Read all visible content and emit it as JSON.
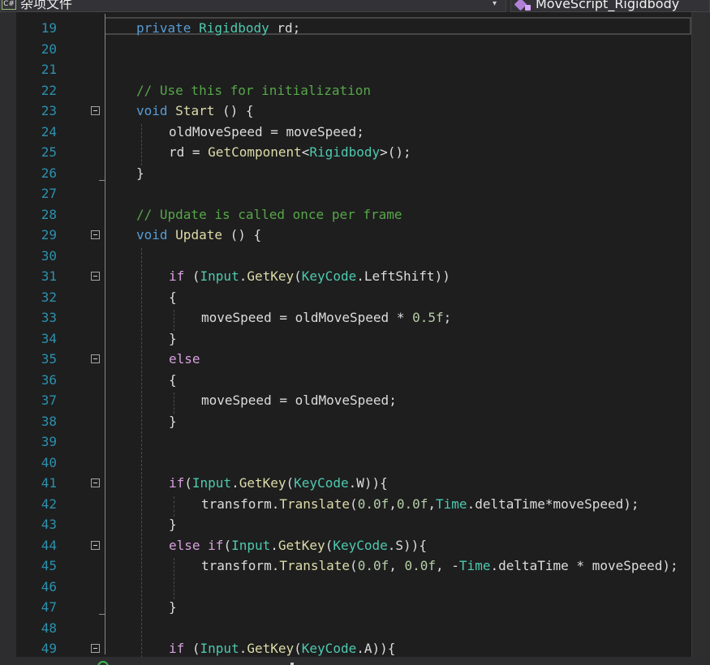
{
  "navbar": {
    "project_badge": "C#",
    "project_label": "杂项文件",
    "chevron": "▾",
    "class_label": "MoveScript_Rigidbody",
    "class_icon": "class-icon"
  },
  "editor": {
    "current_line": 19,
    "lines": [
      {
        "n": 19,
        "indent": 0,
        "tokens": [
          [
            "kw",
            "private"
          ],
          [
            "id",
            " "
          ],
          [
            "ty",
            "Rigidbody"
          ],
          [
            "id",
            " rd;"
          ]
        ]
      },
      {
        "n": 20,
        "indent": 0,
        "tokens": []
      },
      {
        "n": 21,
        "indent": 0,
        "tokens": []
      },
      {
        "n": 22,
        "indent": 0,
        "tokens": [
          [
            "cm",
            "// Use this for initialization"
          ]
        ]
      },
      {
        "n": 23,
        "indent": 0,
        "fold": true,
        "tokens": [
          [
            "kw",
            "void"
          ],
          [
            "id",
            " "
          ],
          [
            "fn",
            "Start"
          ],
          [
            "pn",
            " () {"
          ]
        ]
      },
      {
        "n": 24,
        "indent": 1,
        "tokens": [
          [
            "id",
            "oldMoveSpeed = moveSpeed;"
          ]
        ]
      },
      {
        "n": 25,
        "indent": 1,
        "tokens": [
          [
            "id",
            "rd = "
          ],
          [
            "fn",
            "GetComponent"
          ],
          [
            "pn",
            "<"
          ],
          [
            "ty",
            "Rigidbody"
          ],
          [
            "pn",
            ">();"
          ]
        ]
      },
      {
        "n": 26,
        "indent": 0,
        "fold_end": true,
        "tokens": [
          [
            "pn",
            "}"
          ]
        ]
      },
      {
        "n": 27,
        "indent": 0,
        "tokens": []
      },
      {
        "n": 28,
        "indent": 0,
        "tokens": [
          [
            "cm",
            "// Update is called once per frame"
          ]
        ]
      },
      {
        "n": 29,
        "indent": 0,
        "fold": true,
        "tokens": [
          [
            "kw",
            "void"
          ],
          [
            "id",
            " "
          ],
          [
            "fn",
            "Update"
          ],
          [
            "pn",
            " () {"
          ]
        ]
      },
      {
        "n": 30,
        "indent": 0,
        "tokens": []
      },
      {
        "n": 31,
        "indent": 1,
        "fold": true,
        "tokens": [
          [
            "ctl",
            "if"
          ],
          [
            "pn",
            " ("
          ],
          [
            "ty",
            "Input"
          ],
          [
            "pn",
            "."
          ],
          [
            "fn",
            "GetKey"
          ],
          [
            "pn",
            "("
          ],
          [
            "ty",
            "KeyCode"
          ],
          [
            "pn",
            "."
          ],
          [
            "id",
            "LeftShift"
          ],
          [
            "pn",
            "))"
          ]
        ]
      },
      {
        "n": 32,
        "indent": 1,
        "tokens": [
          [
            "pn",
            "{"
          ]
        ]
      },
      {
        "n": 33,
        "indent": 2,
        "tokens": [
          [
            "id",
            "moveSpeed = oldMoveSpeed * "
          ],
          [
            "num",
            "0.5f"
          ],
          [
            "pn",
            ";"
          ]
        ]
      },
      {
        "n": 34,
        "indent": 1,
        "tokens": [
          [
            "pn",
            "}"
          ]
        ]
      },
      {
        "n": 35,
        "indent": 1,
        "fold": true,
        "tokens": [
          [
            "ctl",
            "else"
          ]
        ]
      },
      {
        "n": 36,
        "indent": 1,
        "tokens": [
          [
            "pn",
            "{"
          ]
        ]
      },
      {
        "n": 37,
        "indent": 2,
        "tokens": [
          [
            "id",
            "moveSpeed = oldMoveSpeed;"
          ]
        ]
      },
      {
        "n": 38,
        "indent": 1,
        "tokens": [
          [
            "pn",
            "}"
          ]
        ]
      },
      {
        "n": 39,
        "indent": 0,
        "tokens": []
      },
      {
        "n": 40,
        "indent": 0,
        "tokens": []
      },
      {
        "n": 41,
        "indent": 1,
        "fold": true,
        "tokens": [
          [
            "ctl",
            "if"
          ],
          [
            "pn",
            "("
          ],
          [
            "ty",
            "Input"
          ],
          [
            "pn",
            "."
          ],
          [
            "fn",
            "GetKey"
          ],
          [
            "pn",
            "("
          ],
          [
            "ty",
            "KeyCode"
          ],
          [
            "pn",
            "."
          ],
          [
            "id",
            "W"
          ],
          [
            "pn",
            "))"
          ],
          [
            "pn",
            "{"
          ]
        ]
      },
      {
        "n": 42,
        "indent": 2,
        "tokens": [
          [
            "id",
            "transform"
          ],
          [
            "pn",
            "."
          ],
          [
            "fn",
            "Translate"
          ],
          [
            "pn",
            "("
          ],
          [
            "num",
            "0.0f"
          ],
          [
            "pn",
            ","
          ],
          [
            "num",
            "0.0f"
          ],
          [
            "pn",
            ","
          ],
          [
            "ty",
            "Time"
          ],
          [
            "pn",
            "."
          ],
          [
            "id",
            "deltaTime*moveSpeed"
          ],
          [
            "pn",
            ");"
          ]
        ]
      },
      {
        "n": 43,
        "indent": 1,
        "tokens": [
          [
            "pn",
            "}"
          ]
        ]
      },
      {
        "n": 44,
        "indent": 1,
        "fold": true,
        "tokens": [
          [
            "ctl",
            "else"
          ],
          [
            "id",
            " "
          ],
          [
            "ctl",
            "if"
          ],
          [
            "pn",
            "("
          ],
          [
            "ty",
            "Input"
          ],
          [
            "pn",
            "."
          ],
          [
            "fn",
            "GetKey"
          ],
          [
            "pn",
            "("
          ],
          [
            "ty",
            "KeyCode"
          ],
          [
            "pn",
            "."
          ],
          [
            "id",
            "S"
          ],
          [
            "pn",
            "))"
          ],
          [
            "pn",
            "{"
          ]
        ]
      },
      {
        "n": 45,
        "indent": 2,
        "tokens": [
          [
            "id",
            "transform"
          ],
          [
            "pn",
            "."
          ],
          [
            "fn",
            "Translate"
          ],
          [
            "pn",
            "("
          ],
          [
            "num",
            "0.0f"
          ],
          [
            "pn",
            ", "
          ],
          [
            "num",
            "0.0f"
          ],
          [
            "pn",
            ", -"
          ],
          [
            "ty",
            "Time"
          ],
          [
            "pn",
            "."
          ],
          [
            "id",
            "deltaTime * moveSpeed"
          ],
          [
            "pn",
            ");"
          ]
        ]
      },
      {
        "n": 46,
        "indent": 0,
        "tokens": []
      },
      {
        "n": 47,
        "indent": 1,
        "fold_end": true,
        "tokens": [
          [
            "pn",
            "}"
          ]
        ]
      },
      {
        "n": 48,
        "indent": 0,
        "tokens": []
      },
      {
        "n": 49,
        "indent": 1,
        "fold": true,
        "tokens": [
          [
            "ctl",
            "if"
          ],
          [
            "pn",
            " ("
          ],
          [
            "ty",
            "Input"
          ],
          [
            "pn",
            "."
          ],
          [
            "fn",
            "GetKey"
          ],
          [
            "pn",
            "("
          ],
          [
            "ty",
            "KeyCode"
          ],
          [
            "pn",
            "."
          ],
          [
            "id",
            "A"
          ],
          [
            "pn",
            "))"
          ],
          [
            "pn",
            "{"
          ]
        ]
      }
    ]
  },
  "status": {
    "icon": "check-circle-icon"
  }
}
